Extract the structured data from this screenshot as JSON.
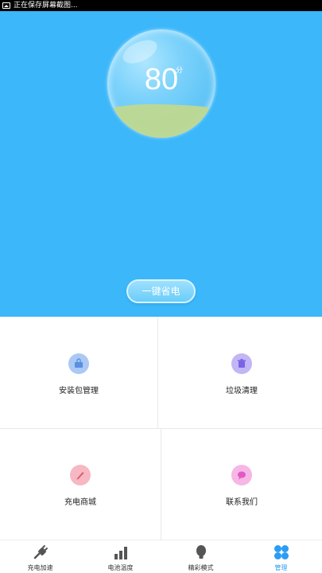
{
  "status_bar": {
    "text": "正在保存屏幕截图..."
  },
  "hero": {
    "score": "80",
    "score_unit": "分",
    "one_key_button": "一键省电"
  },
  "features": [
    {
      "label": "安装包管理",
      "icon": "package-icon",
      "color": "#7fb0f0"
    },
    {
      "label": "垃圾清理",
      "icon": "trash-icon",
      "color": "#9f8ff0"
    },
    {
      "label": "充电商城",
      "icon": "pen-icon",
      "color": "#f08f9f"
    },
    {
      "label": "联系我们",
      "icon": "chat-icon",
      "color": "#f08fd8"
    }
  ],
  "tabs": [
    {
      "label": "充电加速",
      "icon": "plug-icon"
    },
    {
      "label": "电池温度",
      "icon": "bar-chart-icon"
    },
    {
      "label": "精彩模式",
      "icon": "bulb-icon"
    },
    {
      "label": "管理",
      "icon": "clover-icon",
      "active": true
    }
  ],
  "colors": {
    "hero_bg": "#3bb7fa",
    "accent": "#2a9df4",
    "water": "#bfd890"
  }
}
